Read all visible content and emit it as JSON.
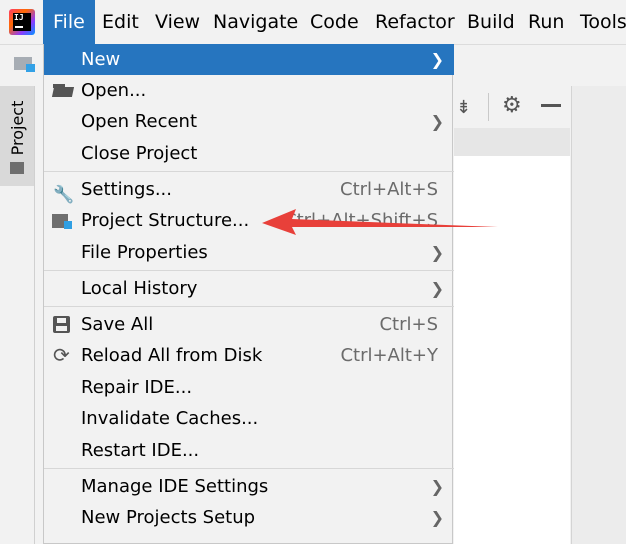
{
  "menubar": {
    "logo_text": "IJ",
    "items": [
      "File",
      "Edit",
      "View",
      "Navigate",
      "Code",
      "Refactor",
      "Build",
      "Run",
      "Tools"
    ]
  },
  "sidebar": {
    "project_tab": "Project"
  },
  "file_menu": {
    "new": "New",
    "open": "Open...",
    "open_recent": "Open Recent",
    "close_project": "Close Project",
    "settings": "Settings...",
    "settings_shortcut": "Ctrl+Alt+S",
    "project_structure": "Project Structure...",
    "project_structure_shortcut": "Ctrl+Alt+Shift+S",
    "file_properties": "File Properties",
    "local_history": "Local History",
    "save_all": "Save All",
    "save_all_shortcut": "Ctrl+S",
    "reload_all": "Reload All from Disk",
    "reload_all_shortcut": "Ctrl+Alt+Y",
    "repair_ide": "Repair IDE...",
    "invalidate_caches": "Invalidate Caches...",
    "restart_ide": "Restart IDE...",
    "manage_ide_settings": "Manage IDE Settings",
    "new_projects_setup": "New Projects Setup"
  },
  "colors": {
    "accent": "#2675bf",
    "annotation_arrow": "#e8403a"
  },
  "icons": {
    "submenu": "chevron-right-icon",
    "open": "folder-open-icon",
    "settings": "wrench-icon",
    "project_structure": "project-structure-icon",
    "save_all": "save-icon",
    "reload": "reload-icon"
  }
}
